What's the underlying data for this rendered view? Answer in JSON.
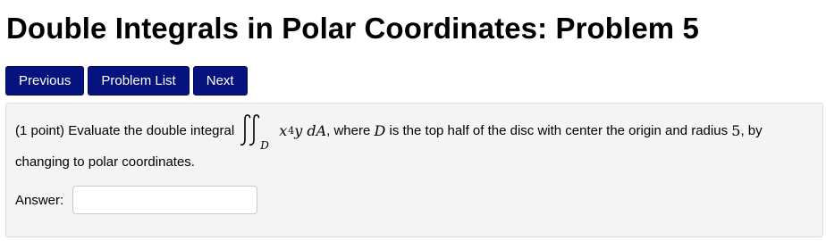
{
  "header": {
    "title": "Double Integrals in Polar Coordinates: Problem 5"
  },
  "nav": {
    "previous_label": "Previous",
    "problem_list_label": "Problem List",
    "next_label": "Next",
    "button_color": "#06137f"
  },
  "problem": {
    "points": "(1 point)",
    "text_before_integral": "Evaluate the double integral",
    "integral_symbol": "double-integral-icon",
    "integral_region": "D",
    "integrand_base": "x",
    "integrand_exponent": "4",
    "integrand_rest": "y dA",
    "text_after_integral": ", where",
    "region_name": "D",
    "text_middle": "is the top half of the disc with center the origin and radius",
    "radius": "5",
    "text_end": ", by",
    "line2": "changing to polar coordinates."
  },
  "answer": {
    "label": "Answer:",
    "value": "",
    "placeholder": ""
  }
}
